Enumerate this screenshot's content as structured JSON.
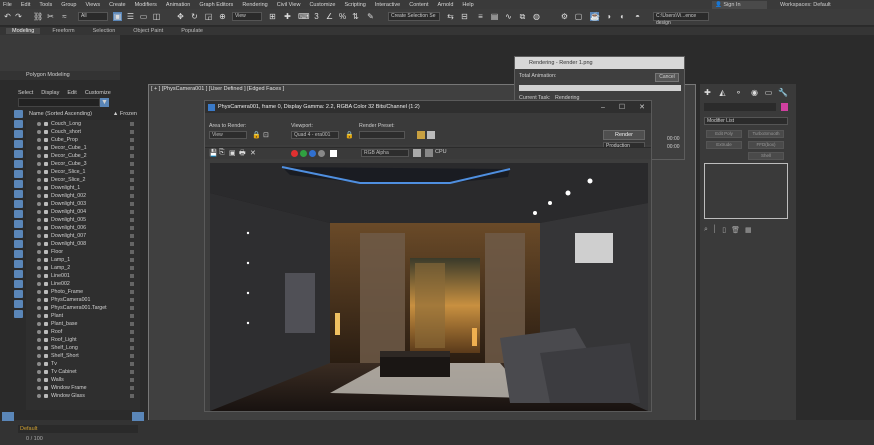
{
  "menu": [
    "File",
    "Edit",
    "Tools",
    "Group",
    "Views",
    "Create",
    "Modifiers",
    "Animation",
    "Graph Editors",
    "Rendering",
    "Civil View",
    "Customize",
    "Scripting",
    "Interactive",
    "Content",
    "Arnold",
    "Help"
  ],
  "signin": "Sign In",
  "workspace": {
    "label": "Workspaces:",
    "value": "Default"
  },
  "toolbar": {
    "filter": "All",
    "view": "View",
    "selection_set": "Create Selection Se",
    "path": "C:\\Users\\Vi...ence design"
  },
  "ribbon": {
    "tabs": [
      "Modeling",
      "Freeform",
      "Selection",
      "Object Paint",
      "Populate"
    ],
    "polygon_modeling": "Polygon Modeling"
  },
  "scene_explorer": {
    "tabs": [
      "Select",
      "Display",
      "Edit",
      "Customize"
    ],
    "col_name": "Name (Sorted Ascending)",
    "col_frozen": "▲ Frozen",
    "items": [
      "Couch_Long",
      "Couch_short",
      "Cube_Prop",
      "Decor_Cube_1",
      "Decor_Cube_2",
      "Decor_Cube_3",
      "Decor_Slice_1",
      "Decor_Slice_2",
      "Downlight_1",
      "Downlight_002",
      "Downlight_003",
      "Downlight_004",
      "Downlight_005",
      "Downlight_006",
      "Downlight_007",
      "Downlight_008",
      "Floor",
      "Lamp_1",
      "Lamp_2",
      "Line001",
      "Line002",
      "Photo_Frame",
      "PhysCamera001",
      "PhysCamera001.Target",
      "Plant",
      "Plant_base",
      "Roof",
      "Roof_Light",
      "Shelf_Long",
      "Shelf_Short",
      "Tv",
      "Tv Cabinet",
      "Walls",
      "Window Frame",
      "Window Glass"
    ]
  },
  "viewport_label": "[ + ] [PhysCamera001 ] [User Defined ] [Edged Faces ]",
  "render_window": {
    "title": "PhysCamera001, frame 0, Display Gamma: 2.2, RGBA Color 32 Bits/Channel (1:2)",
    "area_label": "Area to Render:",
    "area_value": "View",
    "viewport_label": "Viewport:",
    "viewport_value": "Quad 4 - era001",
    "preset_label": "Render Preset:",
    "render_button": "Render",
    "production": "Production",
    "channel": "RGB Alpha",
    "device": "CPU"
  },
  "rendering_status": {
    "title": "Rendering - Render 1.png",
    "total_label": "Total Animation:",
    "cancel": "Cancel",
    "current_task": "Current Task:",
    "task_value": "Rendering",
    "time1": "00:00",
    "time2": "00:00"
  },
  "modify_panel": {
    "modifier_list": "Modifier List",
    "buttons": [
      "Edit Poly",
      "TurboSmooth",
      "Extrude",
      "FFD(box)",
      "Shell",
      ""
    ]
  },
  "status": {
    "default": "Default",
    "frames": "0 / 100"
  },
  "colors": {
    "accent": "#5a86b8",
    "render_dot1": "#e03030",
    "render_dot2": "#30a040",
    "render_dot3": "#3070d0"
  }
}
